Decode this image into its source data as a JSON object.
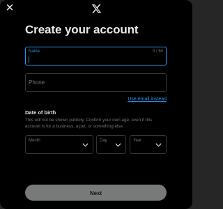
{
  "header": {
    "close_icon": "close-icon",
    "logo": "x-logo"
  },
  "title": "Create your account",
  "name_field": {
    "label": "Name",
    "counter": "0 / 50"
  },
  "phone_field": {
    "placeholder": "Phone"
  },
  "use_email_link": "Use email instead",
  "dob": {
    "title": "Date of birth",
    "description": "This will not be shown publicly. Confirm your own age, even if this account is for a business, a pet, or something else.",
    "month_label": "Month",
    "day_label": "Day",
    "year_label": "Year"
  },
  "next_button": "Next",
  "colors": {
    "accent": "#1d9bf0",
    "background": "#000000",
    "text": "#e7e9ea",
    "muted": "#71767b",
    "button": "#787a7a"
  }
}
